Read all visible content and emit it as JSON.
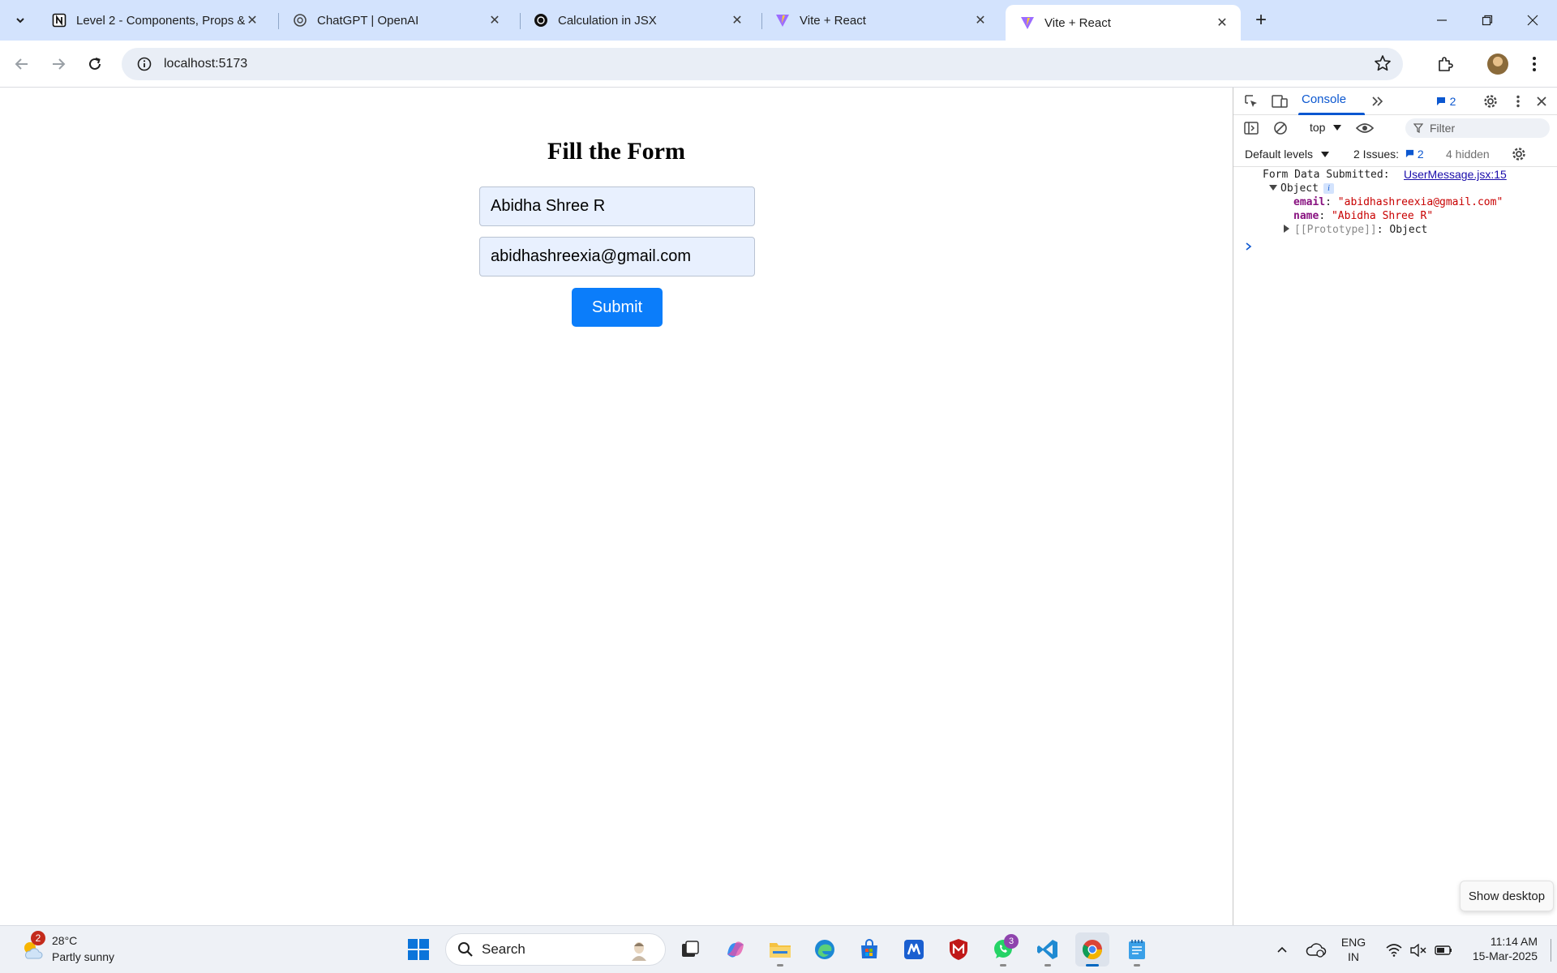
{
  "browser": {
    "tabs": [
      {
        "title": "Level 2 - Components, Props &",
        "favicon": "notion-icon",
        "active": false
      },
      {
        "title": "ChatGPT | OpenAI",
        "favicon": "openai-icon",
        "active": false
      },
      {
        "title": "Calculation in JSX",
        "favicon": "openai-icon",
        "active": false
      },
      {
        "title": "Vite + React",
        "favicon": "vite-icon",
        "active": false
      },
      {
        "title": "Vite + React",
        "favicon": "vite-icon",
        "active": true
      }
    ],
    "url": "localhost:5173"
  },
  "page": {
    "title": "Fill the Form",
    "name_value": "Abidha Shree R",
    "email_value": "abidhashreexia@gmail.com",
    "submit_label": "Submit"
  },
  "devtools": {
    "active_tab": "Console",
    "issues_badge": "2",
    "context": "top",
    "filter_placeholder": "Filter",
    "levels": "Default levels",
    "issues_label": "2 Issues:",
    "issues_count": "2",
    "hidden": "4 hidden",
    "log": {
      "message": "Form Data Submitted:",
      "source": "UserMessage.jsx:15",
      "object_label": "Object",
      "info": "i",
      "props": [
        {
          "key": "email",
          "value": "\"abidhashreexia@gmail.com\""
        },
        {
          "key": "name",
          "value": "\"Abidha Shree R\""
        }
      ],
      "proto_key": "[[Prototype]]",
      "proto_value": "Object"
    }
  },
  "tooltip": "Show desktop",
  "taskbar": {
    "weather_badge": "2",
    "temperature": "28°C",
    "condition": "Partly sunny",
    "search_label": "Search",
    "whatsapp_badge": "3",
    "language_line1": "ENG",
    "language_line2": "IN",
    "time": "11:14 AM",
    "date": "15-Mar-2025"
  },
  "colors": {
    "tabstrip": "#d3e3fd",
    "submit": "#0b7dfa",
    "input_fill": "#e8f0fe",
    "console_link": "#1a0dab",
    "prop_key": "#881280",
    "prop_string": "#c80000"
  }
}
